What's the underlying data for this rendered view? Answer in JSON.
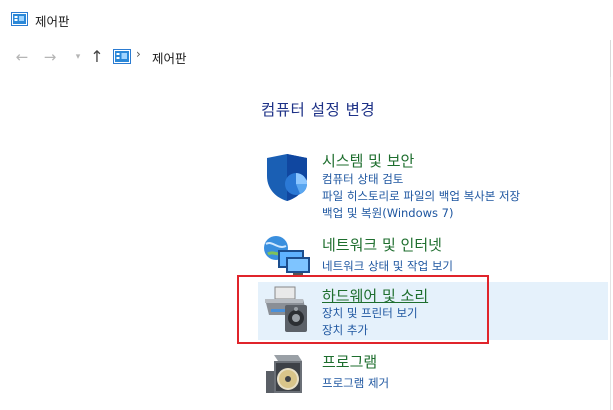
{
  "window": {
    "title": "제어판",
    "icon": "control-panel-icon"
  },
  "nav": {
    "back_icon": "arrow-left-icon",
    "forward_icon": "arrow-right-icon",
    "recent_icon": "chevron-down-icon",
    "up_icon": "arrow-up-icon",
    "breadcrumb": "제어판",
    "breadcrumb_sep": "›"
  },
  "main": {
    "heading": "컴퓨터 설정 변경",
    "categories": [
      {
        "title": "시스템 및 보안",
        "icon": "shield-icon",
        "links": [
          "컴퓨터 상태 검토",
          "파일 히스토리로 파일의 백업 복사본 저장",
          "백업 및 복원(Windows 7)"
        ]
      },
      {
        "title": "네트워크 및 인터넷",
        "icon": "network-globe-icon",
        "links": [
          "네트워크 상태 및 작업 보기"
        ]
      },
      {
        "title": "하드웨어 및 소리",
        "icon": "printer-speaker-icon",
        "links": [
          "장치 및 프린터 보기",
          "장치 추가"
        ],
        "hovered": true
      },
      {
        "title": "프로그램",
        "icon": "programs-disc-icon",
        "links": [
          "프로그램 제거"
        ]
      }
    ]
  },
  "colors": {
    "heading": "#1e3287",
    "category_title": "#1e6e2e",
    "link": "#1e56a0",
    "hover_bg": "#e5f1fb",
    "highlight_border": "#e0242b"
  }
}
